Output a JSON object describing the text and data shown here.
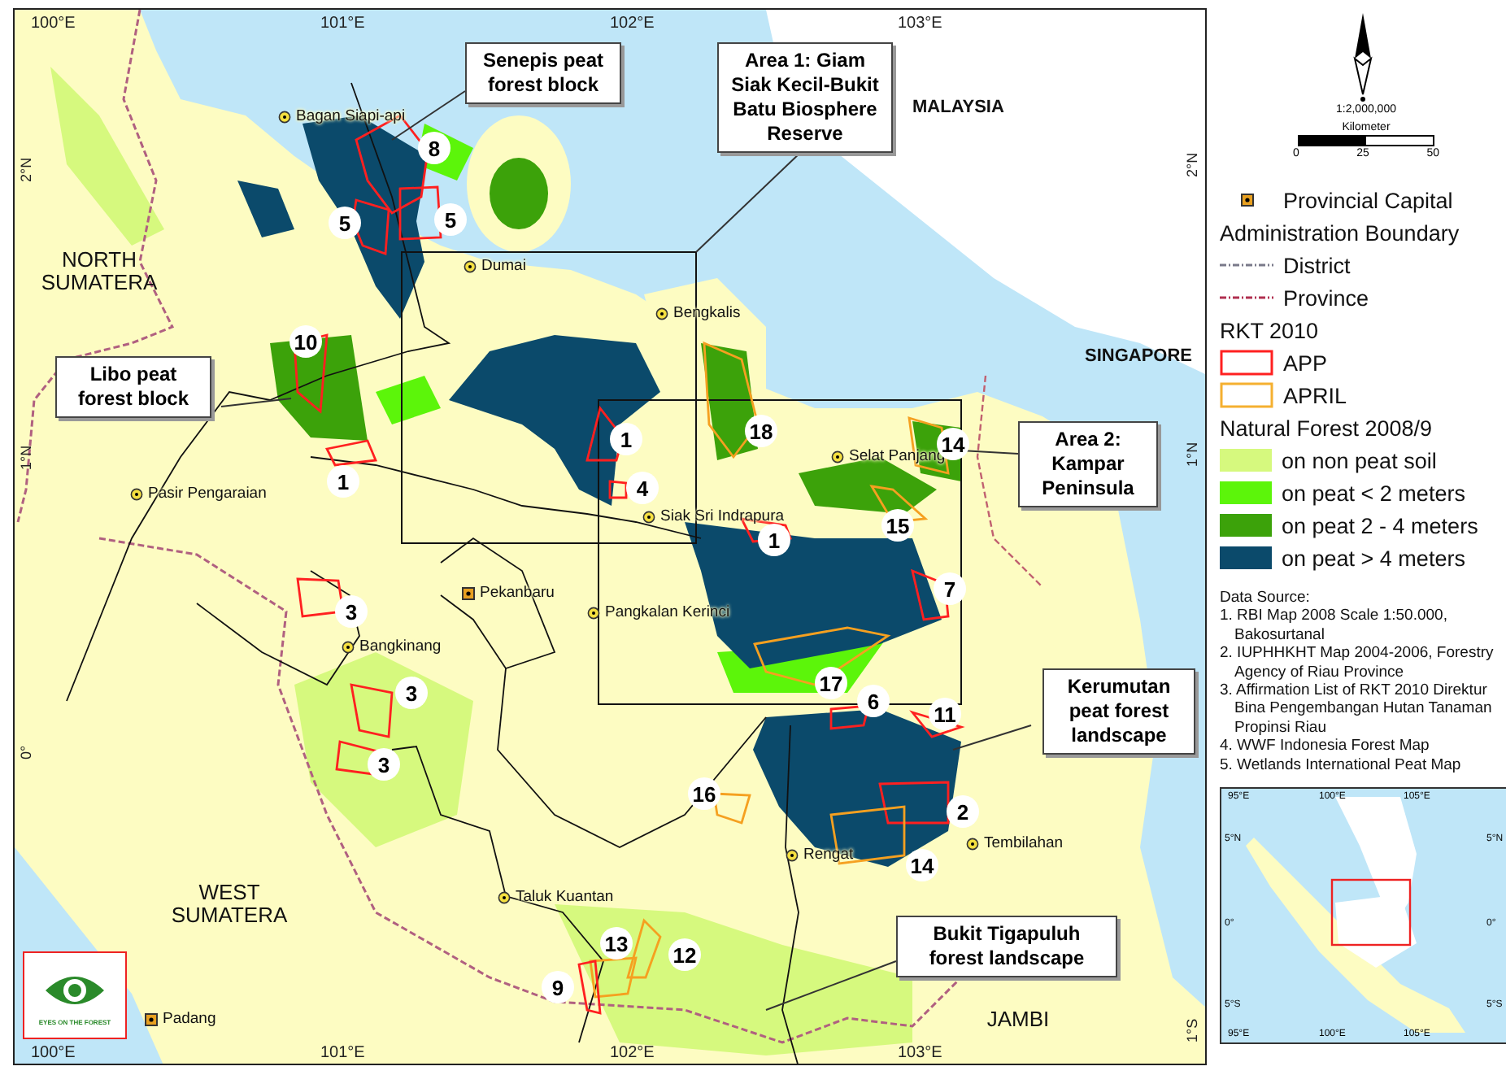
{
  "map": {
    "lon_top": [
      "100°E",
      "101°E",
      "102°E",
      "103°E"
    ],
    "lon_bottom": [
      "100°E",
      "101°E",
      "102°E",
      "103°E"
    ],
    "lat_left": [
      "2°N",
      "1°N",
      "0°"
    ],
    "lat_right": [
      "2°N",
      "1°N",
      "1°S"
    ],
    "regions": [
      {
        "name": "NORTH SUMATERA",
        "kind": "province"
      },
      {
        "name": "WEST SUMATERA",
        "kind": "province"
      },
      {
        "name": "MALAYSIA",
        "kind": "country"
      },
      {
        "name": "SINGAPORE",
        "kind": "country"
      },
      {
        "name": "JAMBI",
        "kind": "province"
      }
    ],
    "towns": [
      {
        "name": "Bagan Siapi-api",
        "kind": "town"
      },
      {
        "name": "Dumai",
        "kind": "town"
      },
      {
        "name": "Bengkalis",
        "kind": "town"
      },
      {
        "name": "Selat Panjang",
        "kind": "town"
      },
      {
        "name": "Siak Sri Indrapura",
        "kind": "town"
      },
      {
        "name": "Pasir Pengaraian",
        "kind": "town"
      },
      {
        "name": "Pekanbaru",
        "kind": "capital"
      },
      {
        "name": "Pangkalan Kerinci",
        "kind": "town"
      },
      {
        "name": "Bangkinang",
        "kind": "town"
      },
      {
        "name": "Rengat",
        "kind": "town"
      },
      {
        "name": "Tembilahan",
        "kind": "town"
      },
      {
        "name": "Taluk Kuantan",
        "kind": "town"
      },
      {
        "name": "Padang",
        "kind": "capital"
      }
    ],
    "concessions": [
      {
        "label": "8",
        "kind": "app"
      },
      {
        "label": "5",
        "kind": "app"
      },
      {
        "label": "5",
        "kind": "app"
      },
      {
        "label": "10",
        "kind": "app"
      },
      {
        "label": "1",
        "kind": "app"
      },
      {
        "label": "1",
        "kind": "app"
      },
      {
        "label": "4",
        "kind": "app"
      },
      {
        "label": "18",
        "kind": "april"
      },
      {
        "label": "14",
        "kind": "april"
      },
      {
        "label": "15",
        "kind": "april"
      },
      {
        "label": "1",
        "kind": "app"
      },
      {
        "label": "7",
        "kind": "app"
      },
      {
        "label": "17",
        "kind": "april"
      },
      {
        "label": "6",
        "kind": "app"
      },
      {
        "label": "11",
        "kind": "app"
      },
      {
        "label": "3",
        "kind": "app"
      },
      {
        "label": "3",
        "kind": "app"
      },
      {
        "label": "3",
        "kind": "app"
      },
      {
        "label": "16",
        "kind": "april"
      },
      {
        "label": "2",
        "kind": "app"
      },
      {
        "label": "14",
        "kind": "april"
      },
      {
        "label": "13",
        "kind": "april"
      },
      {
        "label": "12",
        "kind": "april"
      },
      {
        "label": "9",
        "kind": "app"
      }
    ],
    "callouts": [
      {
        "text": "Senepis peat forest block"
      },
      {
        "text": "Area 1: Giam Siak Kecil-Bukit Batu Biosphere Reserve"
      },
      {
        "text": "Libo peat forest block"
      },
      {
        "text": "Area 2: Kampar Peninsula"
      },
      {
        "text": "Kerumutan peat forest landscape"
      },
      {
        "text": "Bukit Tigapuluh forest landscape"
      }
    ],
    "logo": {
      "text": "EYES ON THE FOREST"
    }
  },
  "legend": {
    "scale": "1:2,000,000",
    "scale_unit": "Kilometer",
    "scale_ticks": [
      "0",
      "25",
      "50"
    ],
    "items": [
      {
        "kind": "capital",
        "label": "Provincial Capital"
      },
      {
        "kind": "heading",
        "label": "Administration Boundary"
      },
      {
        "kind": "line",
        "label": "District",
        "color": "#7a7a8a"
      },
      {
        "kind": "line",
        "label": "Province",
        "color": "#b03050"
      },
      {
        "kind": "heading",
        "label": "RKT 2010"
      },
      {
        "kind": "outline",
        "label": "APP",
        "color": "#ff2020"
      },
      {
        "kind": "outline",
        "label": "APRIL",
        "color": "#f5b030"
      },
      {
        "kind": "heading",
        "label": "Natural Forest 2008/9"
      },
      {
        "kind": "swatch",
        "label": "on non peat soil",
        "color": "#d6f97e"
      },
      {
        "kind": "swatch",
        "label": "on peat < 2 meters",
        "color": "#5cf50a"
      },
      {
        "kind": "swatch",
        "label": "on peat 2 - 4 meters",
        "color": "#3ca20a"
      },
      {
        "kind": "swatch",
        "label": "on peat > 4 meters",
        "color": "#0b4a6b"
      }
    ]
  },
  "data_source": {
    "title": "Data Source:",
    "items": [
      "1. RBI Map 2008 Scale 1:50.000, Bakosurtanal",
      "2. IUPHHKHT Map 2004-2006, Forestry Agency of Riau Province",
      "3. Affirmation List of RKT 2010 Direktur Bina Pengembangan Hutan Tanaman Propinsi Riau",
      "4. WWF Indonesia Forest Map",
      "5. Wetlands International Peat Map"
    ]
  },
  "inset": {
    "lon_top": [
      "95°E",
      "100°E",
      "105°E"
    ],
    "lon_bottom": [
      "95°E",
      "100°E",
      "105°E"
    ],
    "lat_left": [
      "5°N",
      "0°",
      "5°S"
    ],
    "lat_right": [
      "5°N",
      "0°",
      "5°S"
    ]
  }
}
